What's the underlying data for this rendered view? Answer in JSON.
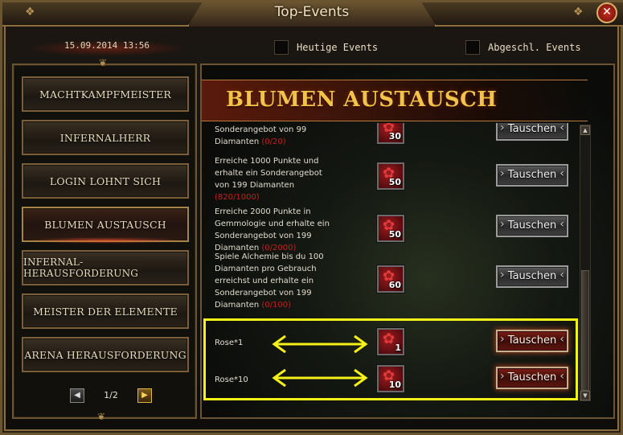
{
  "window": {
    "title": "Top-Events",
    "close_glyph": "✕"
  },
  "header": {
    "datetime": "15.09.2014 13:56",
    "filters": [
      {
        "label": "Heutige Events",
        "checked": false
      },
      {
        "label": "Abgeschl. Events",
        "checked": false
      }
    ]
  },
  "sidebar": {
    "items": [
      {
        "label": "Machtkampfmeister",
        "active": false
      },
      {
        "label": "Infernalherr",
        "active": false
      },
      {
        "label": "Login lohnt sich",
        "active": false
      },
      {
        "label": "Blumen Austausch",
        "active": true
      },
      {
        "label": "Infernal-Herausforderung",
        "active": false
      },
      {
        "label": "Meister der Elemente",
        "active": false
      },
      {
        "label": "Arena Herausforderung",
        "active": false
      }
    ],
    "pager": {
      "text": "1/2",
      "prev_glyph": "◀",
      "next_glyph": "▶"
    }
  },
  "main": {
    "banner_title": "Blumen Austausch",
    "rows": [
      {
        "desc_lines": [
          "Sonderangebot von 99",
          "Diamanten "
        ],
        "progress": "(0/20)",
        "reward_qty": "30",
        "button": "Tauschen",
        "highlight": false
      },
      {
        "desc_lines": [
          "Erreiche 1000 Punkte und",
          "erhalte ein Sonderangebot",
          "von 199 Diamanten"
        ],
        "progress": "(820/1000)",
        "reward_qty": "50",
        "button": "Tauschen",
        "highlight": false
      },
      {
        "desc_lines": [
          "Erreiche 2000 Punkte in",
          "Gemmologie und erhalte ein",
          "Sonderangebot von 199",
          "Diamanten "
        ],
        "progress": "(0/2000)",
        "reward_qty": "50",
        "button": "Tauschen",
        "highlight": false
      },
      {
        "desc_lines": [
          "Spiele Alchemie bis du 100",
          "Diamanten pro Gebrauch",
          "erreichst und erhalte ein",
          "Sonderangebot von 199",
          "Diamanten "
        ],
        "progress": "(0/100)",
        "reward_qty": "60",
        "button": "Tauschen",
        "highlight": false
      },
      {
        "desc_lines": [
          "Rose*1"
        ],
        "progress": "",
        "reward_qty": "1",
        "button": "Tauschen",
        "highlight": true
      },
      {
        "desc_lines": [
          "Rose*10"
        ],
        "progress": "",
        "reward_qty": "10",
        "button": "Tauschen",
        "highlight": true
      }
    ]
  },
  "icons": {
    "reward": "rose-bouquet-icon",
    "scroll_up": "▲",
    "scroll_down": "▼"
  },
  "colors": {
    "annotation": "#f4f018",
    "progress_red": "#c0241b",
    "banner_gold": "#f2c349"
  }
}
